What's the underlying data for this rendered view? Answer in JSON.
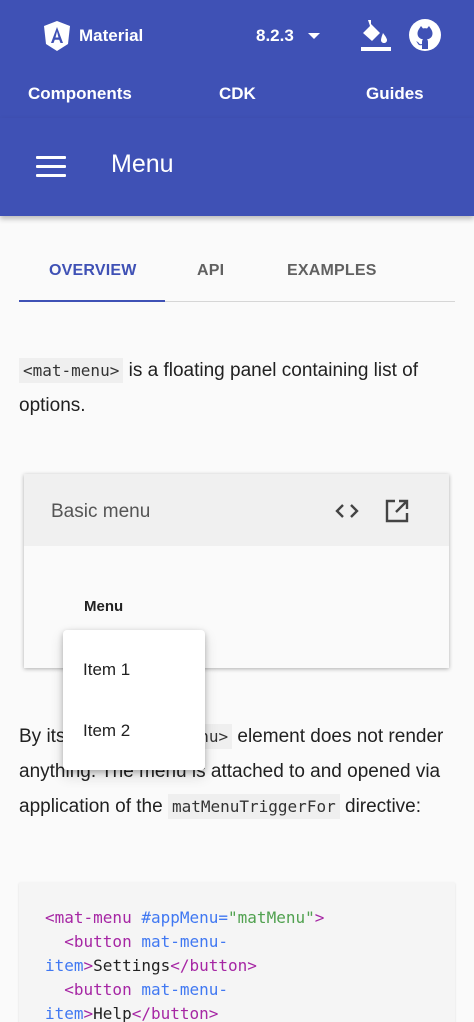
{
  "toolbar": {
    "brand": "Material",
    "version": "8.2.3",
    "icons": {
      "logo": "angular-logo-icon",
      "theme": "format-color-fill-icon",
      "github": "github-icon"
    },
    "nav": [
      "Components",
      "CDK",
      "Guides"
    ]
  },
  "header": {
    "menu_icon": "hamburger-menu-icon",
    "title": "Menu"
  },
  "tabs": [
    "OVERVIEW",
    "API",
    "EXAMPLES"
  ],
  "active_tab": "OVERVIEW",
  "intro": {
    "code": "<mat-menu>",
    "text": " is a floating panel containing list of options."
  },
  "example": {
    "title": "Basic menu",
    "icons": {
      "code": "code-icon",
      "open": "open-in-new-icon"
    },
    "trigger_label": "Menu",
    "menu_items": [
      "Item 1",
      "Item 2"
    ]
  },
  "para2": {
    "text1": "By itself, the ",
    "code1": "<mat-menu>",
    "text2": " element does not render anything. The menu is attached to and opened via application of the ",
    "code2": "matMenuTriggerFor",
    "text3": " directive:"
  },
  "code_sample": {
    "l1_tag": "<mat-menu",
    "l1_attr": " #appMenu=",
    "l1_str": "\"matMenu\"",
    "l1_end": ">",
    "l2_tag": "  <button",
    "l2_attr": " mat-menu-",
    "l3_attr": "item",
    "l3_end": ">",
    "l3_text": "Settings",
    "l3_close": "</button>",
    "l4_tag": "  <button",
    "l4_attr": " mat-menu-",
    "l5_attr": "item",
    "l5_end": ">",
    "l5_text": "Help",
    "l5_close": "</button>"
  },
  "colors": {
    "primary": "#3f51b5",
    "background": "#fafafa"
  }
}
